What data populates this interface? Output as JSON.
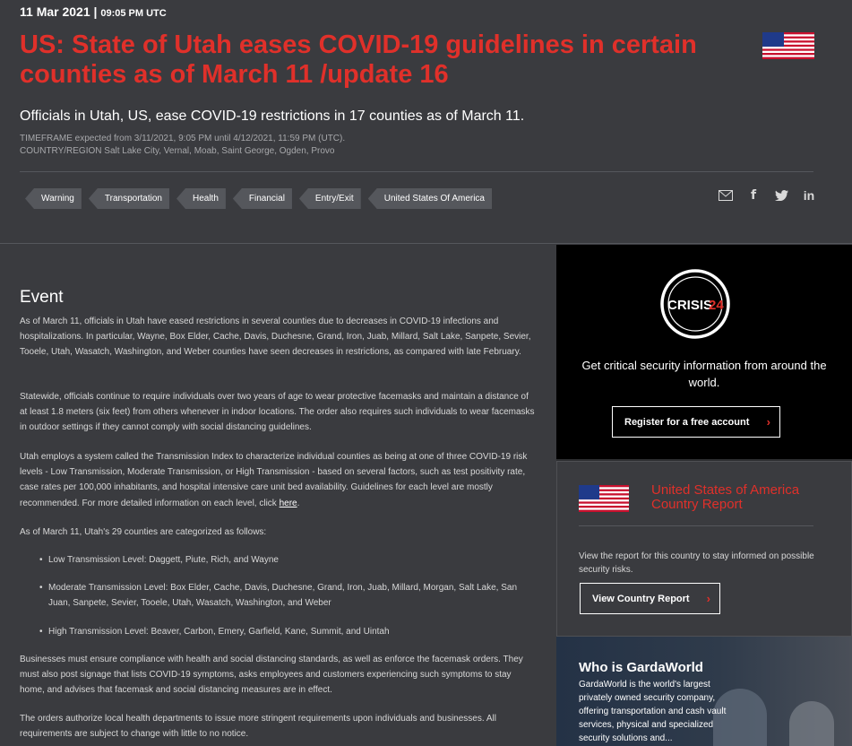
{
  "header": {
    "date": "11 Mar 2021",
    "separator": " | ",
    "time": "09:05 PM UTC",
    "headline": "US: State of Utah eases COVID-19 guidelines in certain counties as of March 11 /update 16",
    "subheadline": "Officials in Utah, US, ease COVID-19 restrictions in 17 counties as of March 11.",
    "timeframe_label": "TIMEFRAME",
    "timeframe_value": " expected from 3/11/2021, 9:05 PM until 4/12/2021, 11:59 PM (UTC).",
    "region_label": "COUNTRY/REGION",
    "region_value": " Salt Lake City, Vernal, Moab, Saint George, Ogden, Provo"
  },
  "tags": [
    "Warning",
    "Transportation",
    "Health",
    "Financial",
    "Entry/Exit",
    "United States Of America"
  ],
  "share_icons": [
    "mail-icon",
    "facebook-icon",
    "twitter-icon",
    "linkedin-icon"
  ],
  "article": {
    "section_title": "Event",
    "p1": "As of March 11, officials in Utah have eased restrictions in several counties due to decreases in COVID-19 infections and hospitalizations. In particular, Wayne, Box Elder, Cache, Davis, Duchesne, Grand, Iron, Juab, Millard, Salt Lake, Sanpete, Sevier, Tooele, Utah, Wasatch, Washington, and Weber counties have seen decreases in restrictions, as compared with late February.",
    "p2": "Statewide, officials continue to require individuals over two years of age to wear protective facemasks and maintain a distance of at least 1.8 meters (six feet) from others whenever in indoor locations. The order also requires such individuals to wear facemasks in outdoor settings if they cannot comply with social distancing guidelines.",
    "p3": "Utah employs a system called the Transmission Index to characterize individual counties as being at one of three COVID-19 risk levels - Low Transmission, Moderate Transmission, or High Transmission - based on several factors, such as test positivity rate, case rates per 100,000 inhabitants, and hospital intensive care unit bed availability. Guidelines for each level are mostly recommended. For more detailed information on each level, click ",
    "p3_link": "here",
    "p3_end": ".",
    "p4": "As of March 11, Utah's 29 counties are categorized as follows:",
    "bullet1": "Low Transmission Level: Daggett, Piute, Rich, and Wayne",
    "bullet2": "Moderate Transmission Level: Box Elder, Cache, Davis, Duchesne, Grand, Iron, Juab, Millard, Morgan, Salt Lake, San Juan, Sanpete, Sevier, Tooele, Utah, Wasatch, Washington, and Weber",
    "bullet3": "High Transmission Level: Beaver, Carbon, Emery, Garfield, Kane, Summit, and Uintah",
    "p5": "Businesses must ensure compliance with health and social distancing standards, as well as enforce the facemask orders. They must also post signage that lists COVID-19 symptoms, asks employees and customers experiencing such symptoms to stay home, and advises that facemask and social distancing measures are in effect.",
    "p6": "The orders authorize local health departments to issue more stringent requirements upon individuals and businesses. All requirements are subject to change with little to no notice."
  },
  "sidebar": {
    "logo_text": "CRISIS",
    "logo_number": "24",
    "promo_text": "Get critical security information from around the world.",
    "register_label": "Register for a free account",
    "report_title": "United States of America Country Report",
    "report_text": "View the report for this country to stay informed on possible security risks.",
    "report_button": "View Country Report",
    "who_title": "Who is GardaWorld",
    "who_text": "GardaWorld is the world's largest privately owned security company, offering transportation and cash vault services, physical and specialized security solutions and..."
  },
  "colors": {
    "accent": "#e0302a",
    "background": "#3a3b3f",
    "promo_bg": "#000000"
  }
}
